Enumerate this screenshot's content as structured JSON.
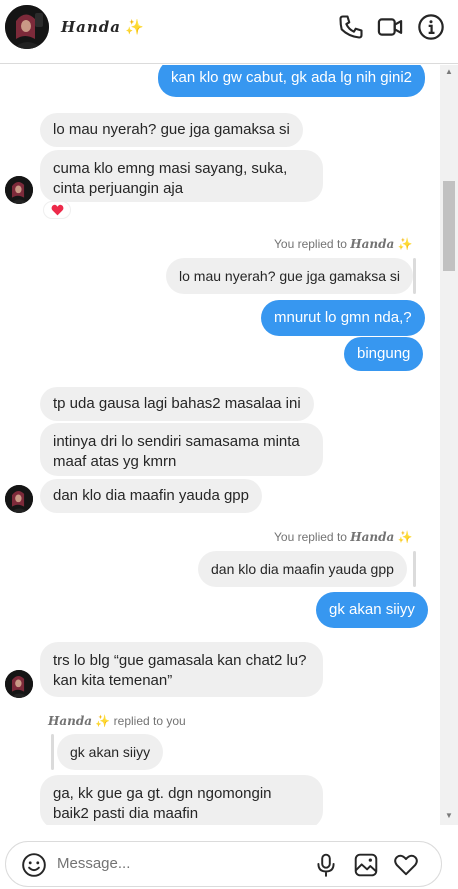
{
  "header": {
    "name": "Handa",
    "sparkle": "✨",
    "icons": [
      "phone-icon",
      "video-icon",
      "info-icon"
    ]
  },
  "messages": {
    "m1": "kan klo gw cabut, gk ada lg nih gini2",
    "m2": "lo mau nyerah? gue jga gamaksa si",
    "m3": "cuma klo emng masi sayang, suka, cinta perjuangin aja",
    "m3_reaction": "♥",
    "r1_label": "You replied to",
    "r1_quote": "lo mau nyerah? gue jga gamaksa si",
    "m4": "mnurut lo gmn nda,?",
    "m5": "bingung",
    "m6": "tp uda gausa lagi bahas2 masalaa ini",
    "m7": "intinya dri lo sendiri samasama minta maaf atas yg kmrn",
    "m8": "dan klo dia maafin yauda gpp",
    "r2_label": "You replied to",
    "r2_quote": "dan klo dia maafin yauda gpp",
    "m9": "gk akan siiyy",
    "m10": "trs lo blg “gue gamasala kan chat2 lu? kan kita temenan”",
    "r3_label": "replied to you",
    "r3_quote": "gk akan siiyy",
    "m11": "ga, kk gue ga gt. dgn ngomongin baik2 pasti dia maafin"
  },
  "composer": {
    "placeholder": "Message..."
  },
  "colors": {
    "outgoing": "#3797f0",
    "incoming": "#efefef",
    "sparkle": "#f2c21b"
  }
}
